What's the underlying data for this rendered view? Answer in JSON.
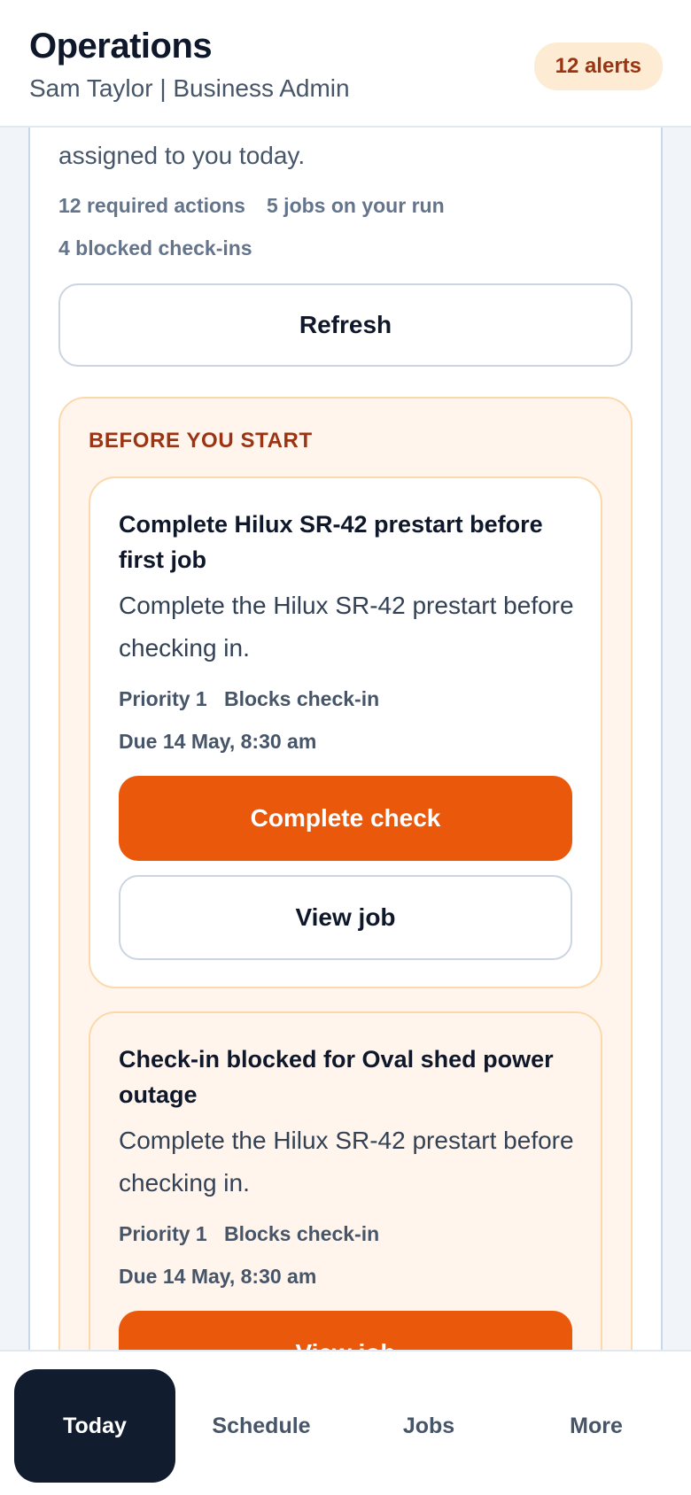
{
  "header": {
    "title": "Operations",
    "user_line": "Sam Taylor | Business Admin",
    "alerts": "12 alerts"
  },
  "summary": {
    "intro": "assigned to you today.",
    "stats": [
      "12 required actions",
      "5 jobs on your run",
      "4 blocked check-ins"
    ],
    "refresh_label": "Refresh"
  },
  "before_start": {
    "title": "BEFORE YOU START",
    "tasks": [
      {
        "title": "Complete Hilux SR-42 prestart before first job",
        "description": "Complete the Hilux SR-42 prestart before checking in.",
        "priority": "Priority 1",
        "flag": "Blocks check-in",
        "due": "Due 14 May, 8:30 am",
        "primary_action": "Complete check",
        "secondary_action": "View job"
      },
      {
        "title": "Check-in blocked for Oval shed power outage",
        "description": "Complete the Hilux SR-42 prestart before checking in.",
        "priority": "Priority 1",
        "flag": "Blocks check-in",
        "due": "Due 14 May, 8:30 am",
        "primary_action": "View job"
      }
    ]
  },
  "tabbar": {
    "tabs": [
      "Today",
      "Schedule",
      "Jobs",
      "More"
    ],
    "active": "Today"
  },
  "colors": {
    "accent": "#ea580c",
    "alert_bg": "#fdebd3",
    "alert_text": "#9a3412",
    "section_bg": "#fff5ec",
    "nav_active": "#111c2e"
  }
}
